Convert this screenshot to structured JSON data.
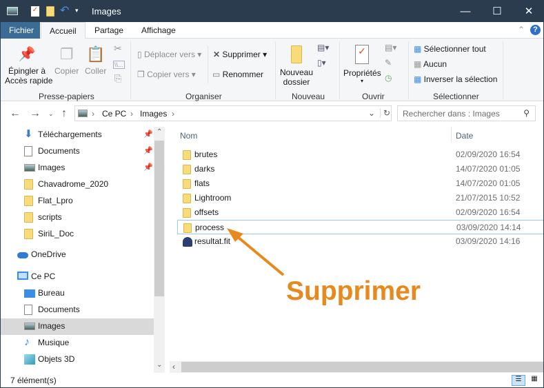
{
  "window": {
    "title": "Images"
  },
  "tabs": {
    "file": "Fichier",
    "home": "Accueil",
    "share": "Partage",
    "view": "Affichage"
  },
  "ribbon": {
    "clipboard": {
      "pin": "Épingler à\nAccès rapide",
      "pin1": "Épingler à",
      "pin2": "Accès rapide",
      "copy": "Copier",
      "paste": "Coller",
      "group": "Presse-papiers"
    },
    "organize": {
      "move": "Déplacer vers",
      "copyto": "Copier vers",
      "delete": "Supprimer",
      "rename": "Renommer",
      "group": "Organiser"
    },
    "new": {
      "folder1": "Nouveau",
      "folder2": "dossier",
      "group": "Nouveau"
    },
    "open": {
      "properties": "Propriétés",
      "group": "Ouvrir"
    },
    "select": {
      "all": "Sélectionner tout",
      "none": "Aucun",
      "invert": "Inverser la sélection",
      "group": "Sélectionner"
    }
  },
  "address": {
    "crumbs": [
      "Ce PC",
      "Images"
    ]
  },
  "search": {
    "placeholder": "Rechercher dans : Images"
  },
  "nav": {
    "items": [
      {
        "label": "Téléchargements",
        "icon": "download-icon",
        "pinned": true
      },
      {
        "label": "Documents",
        "icon": "document-icon",
        "pinned": true
      },
      {
        "label": "Images",
        "icon": "pictures-icon",
        "pinned": true
      },
      {
        "label": "Chavadrome_2020",
        "icon": "folder-icon"
      },
      {
        "label": "Flat_Lpro",
        "icon": "folder-icon"
      },
      {
        "label": "scripts",
        "icon": "folder-icon"
      },
      {
        "label": "SiriL_Doc",
        "icon": "folder-icon"
      },
      {
        "label": "OneDrive",
        "icon": "cloud-icon"
      },
      {
        "label": "Ce PC",
        "icon": "computer-icon"
      },
      {
        "label": "Bureau",
        "icon": "desktop-icon"
      },
      {
        "label": "Documents",
        "icon": "document-icon"
      },
      {
        "label": "Images",
        "icon": "pictures-icon",
        "selected": true
      },
      {
        "label": "Musique",
        "icon": "music-icon"
      },
      {
        "label": "Objets 3D",
        "icon": "cube-icon"
      }
    ]
  },
  "columns": {
    "name": "Nom",
    "date": "Date"
  },
  "files": [
    {
      "name": "brutes",
      "date": "02/09/2020 16:54",
      "type": "folder"
    },
    {
      "name": "darks",
      "date": "14/07/2020 01:05",
      "type": "folder"
    },
    {
      "name": "flats",
      "date": "14/07/2020 01:05",
      "type": "folder"
    },
    {
      "name": "Lightroom",
      "date": "21/07/2015 10:52",
      "type": "folder"
    },
    {
      "name": "offsets",
      "date": "02/09/2020 16:54",
      "type": "folder"
    },
    {
      "name": "process",
      "date": "03/09/2020 14:14",
      "type": "folder",
      "focused": true
    },
    {
      "name": "resultat.fit",
      "date": "03/09/2020 14:16",
      "type": "file"
    }
  ],
  "annotation": {
    "text": "Supprimer",
    "color": "#e8891e"
  },
  "status": {
    "count": "7 élément(s)"
  }
}
